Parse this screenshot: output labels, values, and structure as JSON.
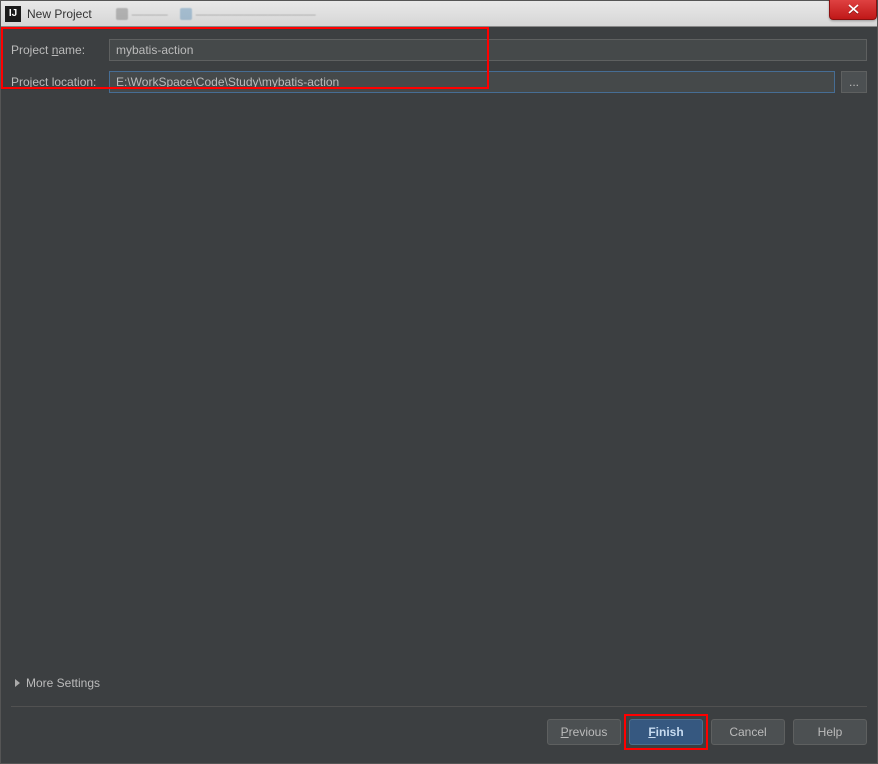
{
  "window": {
    "title": "New Project",
    "icon_glyph": "IJ"
  },
  "form": {
    "project_name_label": "Project name:",
    "project_name_mnemonic": "n",
    "project_name_value": "mybatis-action",
    "project_location_label": "Project location:",
    "project_location_mnemonic": "l",
    "project_location_value": "E:\\WorkSpace\\Code\\Study\\mybatis-action",
    "browse_label": "..."
  },
  "more_settings": {
    "label": "More Settings"
  },
  "buttons": {
    "previous": "Previous",
    "previous_mnemonic": "P",
    "finish": "Finish",
    "finish_mnemonic": "F",
    "cancel": "Cancel",
    "help": "Help"
  }
}
